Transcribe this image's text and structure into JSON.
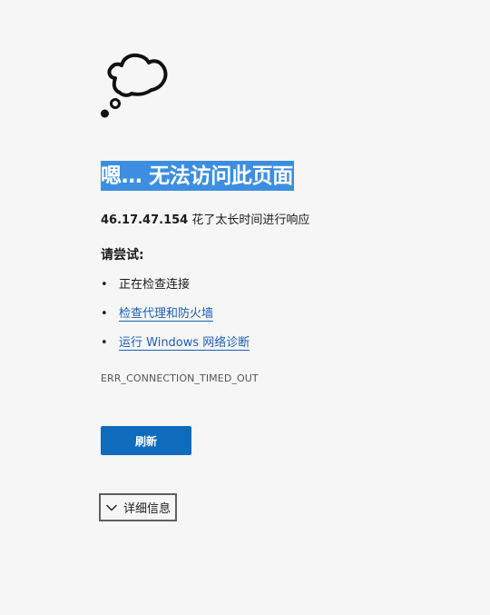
{
  "page": {
    "title": "嗯… 无法访问此页面",
    "host": "46.17.47.154",
    "summary_suffix": " 花了太长时间进行响应",
    "try_heading": "请尝试:",
    "suggestions": [
      {
        "bullet": "•",
        "label": "正在检查连接"
      },
      {
        "bullet": "•",
        "label": "检查代理和防火墙"
      },
      {
        "bullet": "•",
        "label": "运行 Windows 网络诊断"
      }
    ],
    "error_code": "ERR_CONNECTION_TIMED_OUT",
    "refresh_label": "刷新",
    "details_label": "详细信息"
  },
  "icons": {
    "hero": "thought-cloud-icon",
    "details_chevron": "chevron-down-icon"
  },
  "colors": {
    "background": "#f6f6f6",
    "title_highlight": "#3d8ee0",
    "link": "#1a5fb4",
    "primary_button": "#0f6cbd"
  }
}
